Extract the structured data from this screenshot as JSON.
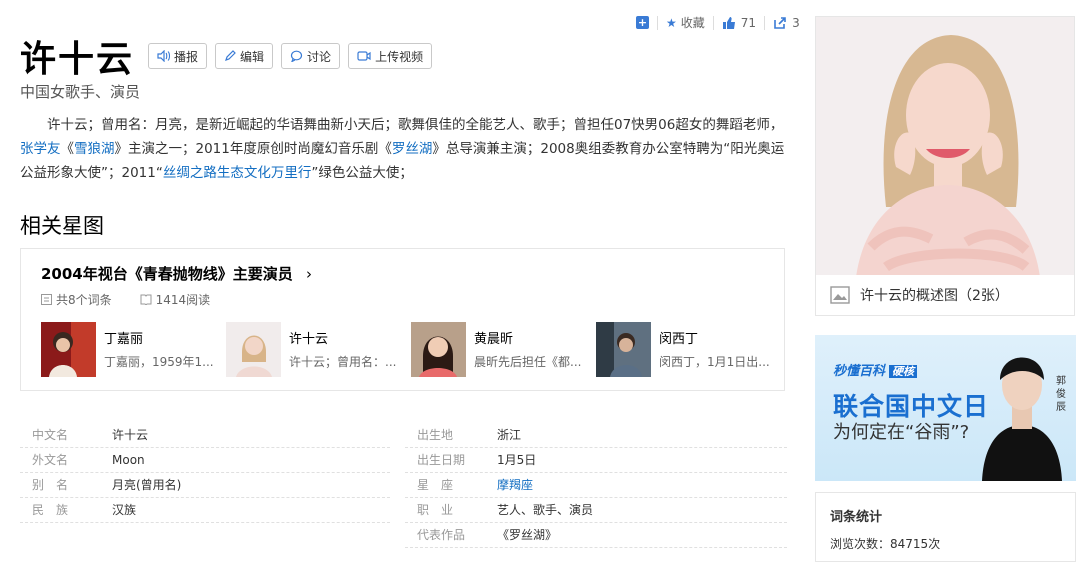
{
  "top_actions": {
    "collect_label": "收藏",
    "like_count": "71",
    "share_count": "3"
  },
  "title": "许十云",
  "title_buttons": {
    "play": "播报",
    "edit": "编辑",
    "discuss": "讨论",
    "upload_video": "上传视频"
  },
  "subtitle": "中国女歌手、演员",
  "summary": {
    "p1": "许十云；曾用名：月亮，是新近崛起的华语舞曲新小天后；歌舞俱佳的全能艺人、歌手；曾担任07快男06超女的舞蹈老师，",
    "link1": "张学友",
    "p2": "《",
    "link2": "雪狼湖",
    "p3": "》主演之一；2011年度原创时尚魔幻音乐剧《",
    "link3": "罗丝湖",
    "p4": "》总导演兼主演；2008奥组委教育办公室特聘为“阳光奥运公益形象大使”；2011“",
    "link4": "丝绸之路生态文化万里行",
    "p5": "”绿色公益大使；"
  },
  "section_title": "相关星图",
  "star_card": {
    "title": "2004年视台《青春抛物线》主要演员",
    "entries_count": "共8个词条",
    "read_count": "1414阅读",
    "people": [
      {
        "name": "丁嘉丽",
        "desc": "丁嘉丽，1959年1..."
      },
      {
        "name": "许十云",
        "desc": "许十云；曾用名：..."
      },
      {
        "name": "黄晨昕",
        "desc": "晨昕先后担任《都..."
      },
      {
        "name": "闵西丁",
        "desc": "闵西丁，1月1日出..."
      }
    ]
  },
  "basic_info": {
    "left": [
      {
        "k": "中文名",
        "v": "许十云"
      },
      {
        "k": "外文名",
        "v": "Moon"
      },
      {
        "k": "别　名",
        "v": "月亮(曾用名)"
      },
      {
        "k": "民　族",
        "v": "汉族"
      }
    ],
    "right": [
      {
        "k": "出生地",
        "v": "浙江"
      },
      {
        "k": "出生日期",
        "v": "1月5日"
      },
      {
        "k": "星　座",
        "v": "摩羯座"
      },
      {
        "k": "职　业",
        "v": "艺人、歌手、演员"
      },
      {
        "k": "代表作品",
        "v": "《罗丝湖》"
      }
    ]
  },
  "sidebar": {
    "photo_caption": "许十云的概述图（2张）",
    "ad": {
      "brand": "秒懂百科",
      "brand_tag": "硬核",
      "headline": "联合国中文日",
      "sub": "为何定在“谷雨”?",
      "person": "郭俊辰"
    },
    "stats": {
      "title": "词条统计",
      "views_label": "浏览次数：",
      "views": "84715次"
    }
  },
  "colors": {
    "link": "#136ec2",
    "accent": "#3a7bd5"
  }
}
